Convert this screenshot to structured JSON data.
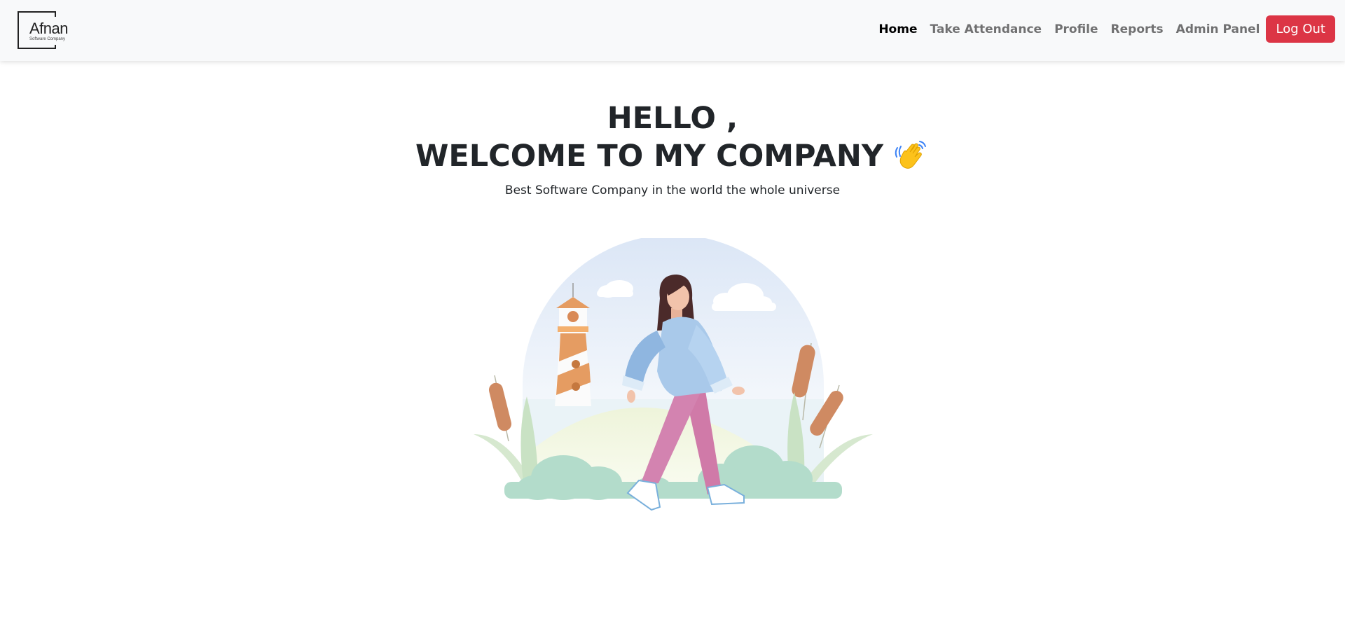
{
  "brand": {
    "name": "Afnan",
    "tagline": "Software Company"
  },
  "nav": {
    "items": [
      {
        "label": "Home",
        "active": true
      },
      {
        "label": "Take Attendance",
        "active": false
      },
      {
        "label": "Profile",
        "active": false
      },
      {
        "label": "Reports",
        "active": false
      },
      {
        "label": "Admin Panel",
        "active": false
      }
    ],
    "logout_label": "Log Out"
  },
  "hero": {
    "line1": "HELLO ,",
    "line2": "WELCOME TO MY COMPANY",
    "subtitle": "Best Software Company in the world the whole universe",
    "emoji_icon": "waving-hand-icon"
  },
  "illustration": {
    "subject": "woman-walking-illustration"
  },
  "colors": {
    "navbar_bg": "#f8f9fa",
    "logout_bg": "#dc3545",
    "text": "#212529"
  }
}
